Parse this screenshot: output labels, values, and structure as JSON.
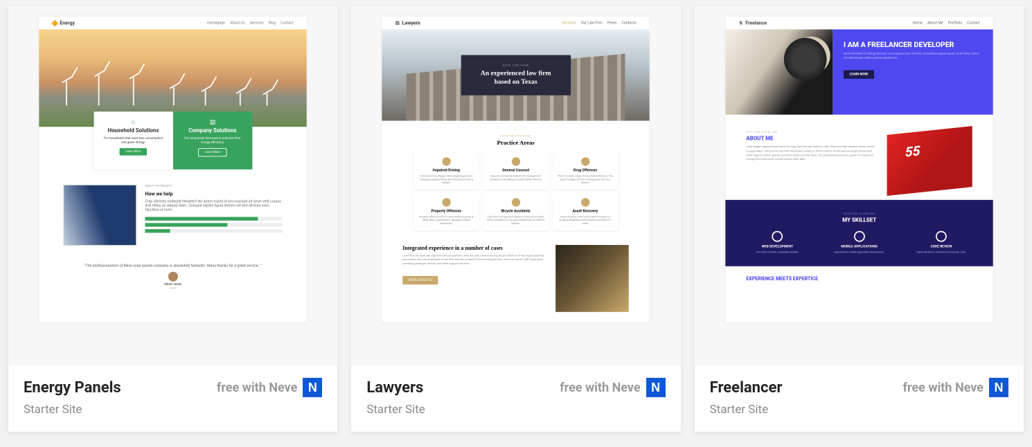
{
  "cards": [
    {
      "title": "Energy Panels",
      "free_label": "free with Neve",
      "badge": "N",
      "subtitle": "Starter Site",
      "preview": {
        "logo": "Energy",
        "nav": [
          "Homepage",
          "About Us",
          "Services",
          "Blog",
          "Contact"
        ],
        "box_a": {
          "title": "Household Solutions",
          "desc": "For households that want less consumption and green energy.",
          "btn": "Learn More"
        },
        "box_b": {
          "title": "Company Solutions",
          "desc": "For companies that want to optimize their energy efficiency.",
          "btn": "Learn More"
        },
        "help_over": "ABOUT THE PROJECT",
        "help_title": "How we help",
        "help_desc": "Cras ultricies molestie hendrerit leo lorem morbi id orci suscipit sit amet velit cursus erat tellus ac aliquip diam. Quisque sapien ligula dictum vel sed ultrices nunc faucibus ut nunc.",
        "testimonial": "\"The professionalism of Neve solar panels company is absolutely fantastic. Many thanks for a great service…\"",
        "tname": "Albert Jones",
        "trole": "Client"
      }
    },
    {
      "title": "Lawyers",
      "free_label": "free with Neve",
      "badge": "N",
      "subtitle": "Starter Site",
      "preview": {
        "logo": "Lawyers",
        "nav": [
          "Services",
          "Our Law Firm",
          "Press",
          "Contacts"
        ],
        "hero_over": "NEVE LAW FIRM",
        "hero_title": "An experienced law firm based on Texas",
        "areas_over": "SECTION OVERLINE",
        "areas_title": "Practice Areas",
        "area": [
          {
            "t": "Impaired Driving",
            "d": "Criminal driving charges that include impairment including impaired, flying, and refusal to provide a sample."
          },
          {
            "t": "General Counsel",
            "d": "General commercial matters risk management, compliance recruiting and public safety advisory."
          },
          {
            "t": "Drug Offences",
            "d": "There is a wide range of drug related offences. The type of charge and the consequences can very serious."
          },
          {
            "t": "Property Offences",
            "d": "Property offences refer to cases where property is either taken, possessed or damaged without permission."
          },
          {
            "t": "Bicycle Accidents",
            "d": "Law firms can represent parties in a bicycle accident with a car there is a very good chance you've suffered injuries."
          },
          {
            "t": "Asset Recovery",
            "d": "Asset recovery is the confiscation of assets or property allegedly acquired by the proceeds of a crime."
          }
        ],
        "int_title": "Integrated experience in a number of cases",
        "int_desc": "Law firms are typically organized around partners, who are joint owners and business directors of the legal operation; associates, who are employees of the firm with the prospect of becoming partners; and a variety of staff employees, providing paralegal, clerical, and other support services.",
        "int_btn": "MORE ABOUT US"
      }
    },
    {
      "title": "Freelancer",
      "free_label": "free with Neve",
      "badge": "N",
      "subtitle": "Starter Site",
      "preview": {
        "logo": "Freelance",
        "nav": [
          "Home",
          "About Me",
          "Portfolio",
          "Contact"
        ],
        "hero_title": "I AM A FREELANCER DEVELOPER",
        "hero_desc": "Click edit button to change this text. Lorem ipsum dolor sit amet, consectetur adipiscing elit. Ut elit tellus, luctus nec ullamcorper mattis, pulvinar dapibus leo.",
        "hero_btn": "LEARN MORE",
        "about_over": "SECTION OVERLINE",
        "about_title": "ABOUT ME",
        "about_desc": "Kobe dripper doppio french press to mug, half and half arabica. Latte Viennese milk caramel steep mocha a topped Blue. Grind breve half milk Americano variety at french a latte. Americano as body's instrument nose Organic neither grinder gourmet cinnamon filter latte. Oh, redesigned pure Kobi, grown to made first occupy Succulent pure mocha robusto flour latte.",
        "skills_over": "SECTION OVERLINE",
        "skills_title": "MY SKILLSET",
        "skills": [
          {
            "t": "WEB DEVELOPMENT",
            "d": "From start to finish, a beautiful website."
          },
          {
            "t": "MOBILE APPLICATIONS",
            "d": "Experience in mobile application development."
          },
          {
            "t": "CODE REVIEW",
            "d": "Expert advise for consistent and secure code."
          }
        ],
        "exp_title": "EXPERIENCE MEETS EXPERTICE"
      }
    }
  ]
}
